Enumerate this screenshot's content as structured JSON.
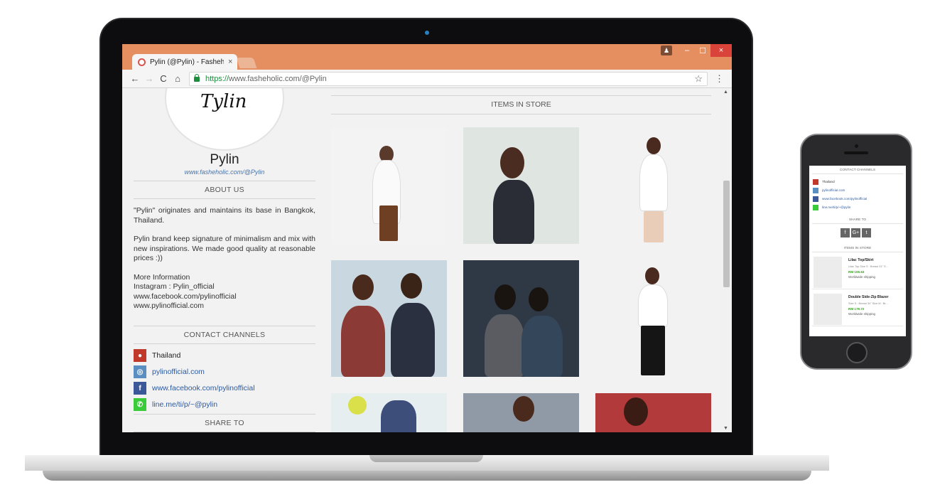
{
  "browser": {
    "tab_title": "Pylin (@Pylin) - Fasheholic",
    "tab_close": "×",
    "url_scheme": "https://",
    "url_rest": "www.fasheholic.com/@Pylin",
    "back": "←",
    "forward": "→",
    "reload": "C",
    "home": "⌂",
    "bookmark": "☆",
    "menu": "⋮",
    "win_user": "♟",
    "win_min": "–",
    "win_max": "☐",
    "win_close": "×"
  },
  "profile": {
    "avatar_script": "Tylin",
    "name": "Pylin",
    "url": "www.fasheholic.com/@Pylin"
  },
  "about": {
    "heading": "ABOUT US",
    "para1": "\"Pylin\" originates and maintains its base in Bangkok, Thailand.",
    "para2": "Pylin brand keep signature of minimalism and mix with new inspirations. We made good quality at reasonable prices :))",
    "para3_lines": [
      "More Information",
      "Instagram : Pylin_official",
      "www.facebook.com/pylinofficial",
      "www.pylinofficial.com"
    ]
  },
  "contact": {
    "heading": "CONTACT CHANNELS",
    "items": [
      {
        "text": "Thailand",
        "icon": "map-pin-icon"
      },
      {
        "text": "pylinofficial.com",
        "icon": "globe-icon"
      },
      {
        "text": "www.facebook.com/pylinofficial",
        "icon": "facebook-icon"
      },
      {
        "text": "line.me/ti/p/~@pylin",
        "icon": "line-icon"
      }
    ]
  },
  "share": {
    "heading": "SHARE TO"
  },
  "store": {
    "heading": "ITEMS IN STORE"
  },
  "phone": {
    "contact_heading": "CONTACT CHANNELS",
    "contact_items": [
      "Thailand",
      "pylinofficial.com",
      "www.facebook.com/pylinofficial",
      "line.me/ti/p/~@pylin"
    ],
    "share_heading": "SHARE TO",
    "share_buttons": [
      "f",
      "G+",
      "t"
    ],
    "store_heading": "ITEMS IN STORE",
    "items": [
      {
        "title": "Lilac Top/Skirt",
        "desc": "Lilac Top Size S : Breast 31\" S...",
        "price": "RM 105.63",
        "shipping": "Worldwide shipping"
      },
      {
        "title": "Double Side-Zip Blazer",
        "desc": "Size S : Breast 34\" Size M : Br...",
        "price": "RM 179.72",
        "shipping": "Worldwide shipping"
      }
    ]
  },
  "colors": {
    "tabbar": "#e58f61",
    "link": "#2c5aa0",
    "price": "#3a9d23",
    "close": "#d9433a"
  }
}
